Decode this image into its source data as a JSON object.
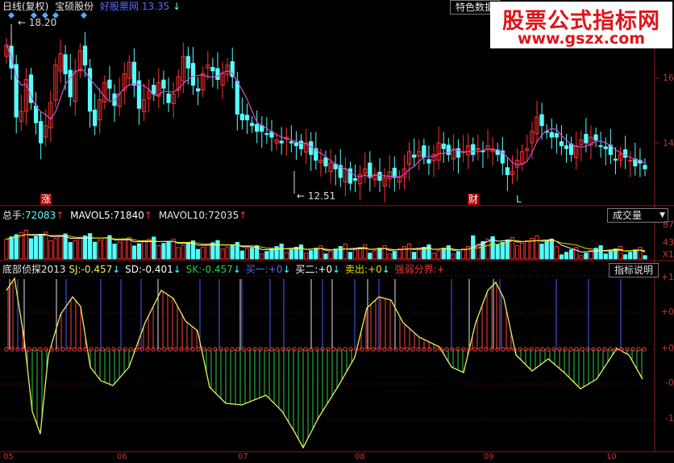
{
  "header": {
    "period": "日线(复权)",
    "stock_name": "宝硕股份",
    "source_label": "好股票网",
    "price": "13.35",
    "price_arrow": "↓",
    "special_button": "特色数据",
    "diamond_icon": "diamond-icon"
  },
  "watermark": {
    "title": "股票公式指标网",
    "url": "www.gszx.com"
  },
  "price_panel": {
    "high_label": "18.20",
    "low_label": "12.51",
    "axis_labels": [
      "16",
      "14"
    ],
    "markers": {
      "zhang": "涨",
      "cai": "财",
      "l": "L"
    },
    "up_color": "#ff3232",
    "down_color": "#54ffff",
    "ma_color": "#d24fd2"
  },
  "volume_panel": {
    "total_label": "总手:",
    "total_value": "72083",
    "mavol5_label": "MAVOL5:",
    "mavol5_value": "71840",
    "mavol10_label": "MAVOL10:",
    "mavol10_value": "72035",
    "dropdown_label": "成交量",
    "axis_labels": [
      "87",
      "43",
      "X1"
    ]
  },
  "indicator_panel": {
    "name": "底部侦探2013",
    "sj_label": "SJ:",
    "sj_value": "-0.457",
    "sd_label": "SD:",
    "sd_value": "-0.401",
    "sk_label": "SK:",
    "sk_value": "-0.457",
    "buy1_label": "买一:",
    "buy1_value": "+0",
    "buy2_label": "买二:",
    "buy2_value": "+0",
    "sell_label": "卖出:",
    "sell_value": "+0",
    "strength_label": "强弱分界:",
    "strength_value": "+",
    "help_button": "指标说明",
    "axis_labels": [
      "+1",
      "+0",
      "+0",
      "-0",
      "-1"
    ]
  },
  "x_axis_labels": [
    "05",
    "06",
    "07",
    "08",
    "09",
    "10"
  ],
  "chart_data": {
    "type": "candlestick",
    "close": [
      17.6,
      16.8,
      15.1,
      15.3,
      16.4,
      15.6,
      14.9,
      14.2,
      14.8,
      15.6,
      16.9,
      17.3,
      16.6,
      15.8,
      16.7,
      17.4,
      16.9,
      15.3,
      14.8,
      15.7,
      16.3,
      16.1,
      15.5,
      15.9,
      16.6,
      17.0,
      16.2,
      15.4,
      15.7,
      16.0,
      15.9,
      16.3,
      16.1,
      15.6,
      15.9,
      16.5,
      17.2,
      16.8,
      16.2,
      16.0,
      16.6,
      16.9,
      16.7,
      16.4,
      16.6,
      16.9,
      16.5,
      15.2,
      15.0,
      15.0,
      14.8,
      14.6,
      14.6,
      14.5,
      14.4,
      14.3,
      14.2,
      14.4,
      14.2,
      14.1,
      14.0,
      14.2,
      13.8,
      13.6,
      13.6,
      13.4,
      13.5,
      13.3,
      13.0,
      13.3,
      12.8,
      12.9,
      13.1,
      13.3,
      13.0,
      13.1,
      12.9,
      13.0,
      13.2,
      13.0,
      13.0,
      13.3,
      13.9,
      13.7,
      13.9,
      13.7,
      13.5,
      13.8,
      14.2,
      14.0,
      13.8,
      14.0,
      13.7,
      13.9,
      14.1,
      13.8,
      14.0,
      13.9,
      14.1,
      14.0,
      13.8,
      13.5,
      13.1,
      13.2,
      13.6,
      13.9,
      14.0,
      14.6,
      15.1,
      14.8,
      14.6,
      14.4,
      14.4,
      14.1,
      14.0,
      13.8,
      14.1,
      14.3,
      14.2,
      14.4,
      14.3,
      14.1,
      14.0,
      13.8,
      13.6,
      13.8,
      13.7,
      13.6,
      13.4,
      13.5,
      13.3
    ],
    "series": [
      {
        "name": "MAVOL5",
        "color": "#ffffff"
      },
      {
        "name": "MAVOL10",
        "color": "#e8e000"
      }
    ]
  },
  "colors": {
    "bg": "#000000",
    "grid": "#8b1a1a",
    "sj_line": "#e8f060",
    "green_bar": "#2ecc40",
    "red_bar": "#ff4040",
    "blue_bar": "#4a5cff"
  }
}
